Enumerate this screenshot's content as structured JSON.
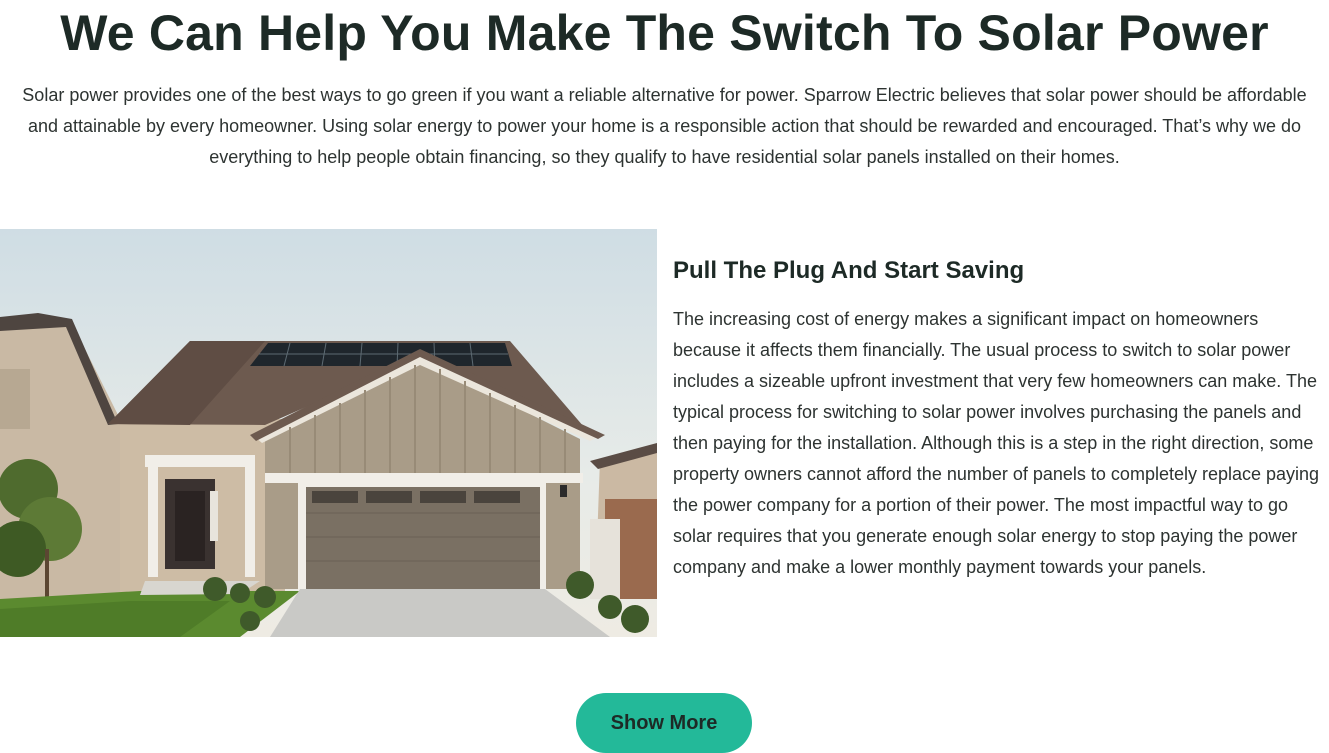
{
  "hero": {
    "title": "We Can Help You Make The Switch To Solar Power",
    "intro": "Solar power provides one of the best ways to go green if you want a reliable alternative for power. Sparrow Electric believes that solar power should be affordable and attainable by every homeowner. Using solar energy to power your home is a responsible action that should be rewarded and encouraged. That’s why we do everything to help people obtain financing, so they qualify to have residential solar panels installed on their homes."
  },
  "feature": {
    "image_subject": "house-with-rooftop-solar-panels",
    "heading": "Pull The Plug And Start Saving",
    "body": "The increasing cost of energy makes a significant impact on homeowners because it affects them financially. The usual process to switch to solar power includes a sizeable upfront investment that very few homeowners can make. The typical process for switching to solar power involves purchasing the panels and then paying for the installation. Although this is a step in the right direction, some property owners cannot afford the number of panels to completely replace paying the power company for a portion of their power. The most impactful way to go solar requires that you generate enough solar energy to stop paying the power company and make a lower monthly payment towards your panels."
  },
  "cta": {
    "show_more_label": "Show More"
  },
  "colors": {
    "heading": "#1d2a26",
    "body_text": "#2d3331",
    "button_bg": "#23b999"
  }
}
